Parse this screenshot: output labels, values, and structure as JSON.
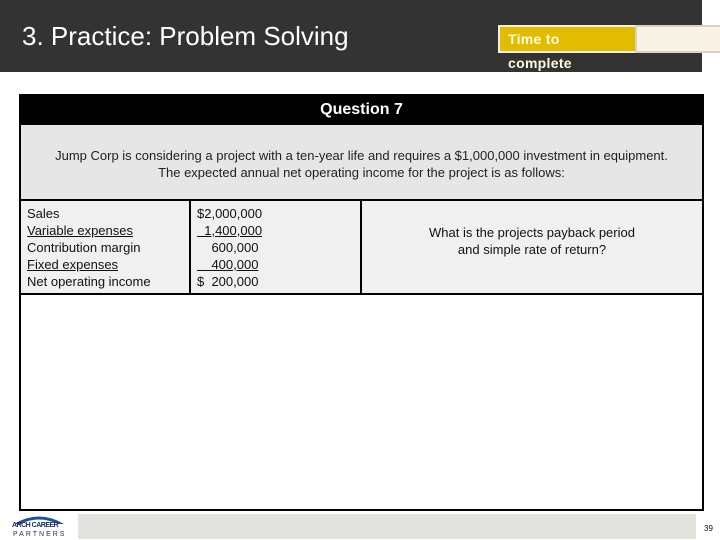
{
  "header": {
    "title": "3. Practice: Problem Solving",
    "timer_label": "Time to complete",
    "timer_value": ""
  },
  "question": {
    "title": "Question 7",
    "prompt_line1": "Jump Corp is considering a project with a ten-year life and requires a $1,000,000 investment in equipment.",
    "prompt_line2": "The expected annual net operating income for the project is as follows:",
    "income_statement": [
      {
        "label": "Sales",
        "value": "$2,000,000",
        "underline": false
      },
      {
        "label": "Variable expenses",
        "value": "  1,400,000",
        "underline": true
      },
      {
        "label": "Contribution margin",
        "value": "    600,000",
        "underline": false
      },
      {
        "label": "Fixed expenses",
        "value": "    400,000",
        "underline": true
      },
      {
        "label": "Net operating income",
        "value": "$  200,000",
        "underline": false
      }
    ],
    "ask_line1": "What is the projects payback period",
    "ask_line2": "and simple rate of return?"
  },
  "footer": {
    "logo_line1": "ARCH CAREER",
    "logo_line2": "PARTNERS",
    "page_number": "39"
  },
  "colors": {
    "header_bg": "#333333",
    "timer_accent": "#e2bc00",
    "question_header_bg": "#000000",
    "prompt_bg": "#e6e6e6",
    "logo_blue": "#1c4f9c"
  }
}
